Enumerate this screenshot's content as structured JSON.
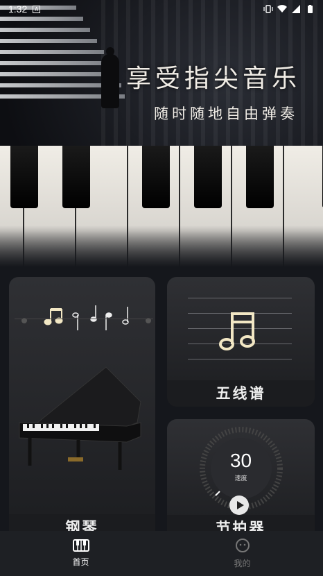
{
  "status_bar": {
    "time": "1:32",
    "notification_icon": "A"
  },
  "banner": {
    "title": "享受指尖音乐",
    "subtitle": "随时随地自由弹奏"
  },
  "cards": {
    "piano": {
      "label": "钢琴"
    },
    "staff": {
      "label": "五线谱"
    },
    "metronome": {
      "label": "节拍器",
      "tempo_value": "30",
      "tempo_unit": "速度"
    }
  },
  "nav": {
    "home_label": "首页",
    "mine_label": "我的"
  },
  "colors": {
    "background": "#15171c",
    "card": "#2f3034",
    "nav_bar": "#1e2024",
    "active": "#ffffff",
    "inactive": "#777777"
  }
}
